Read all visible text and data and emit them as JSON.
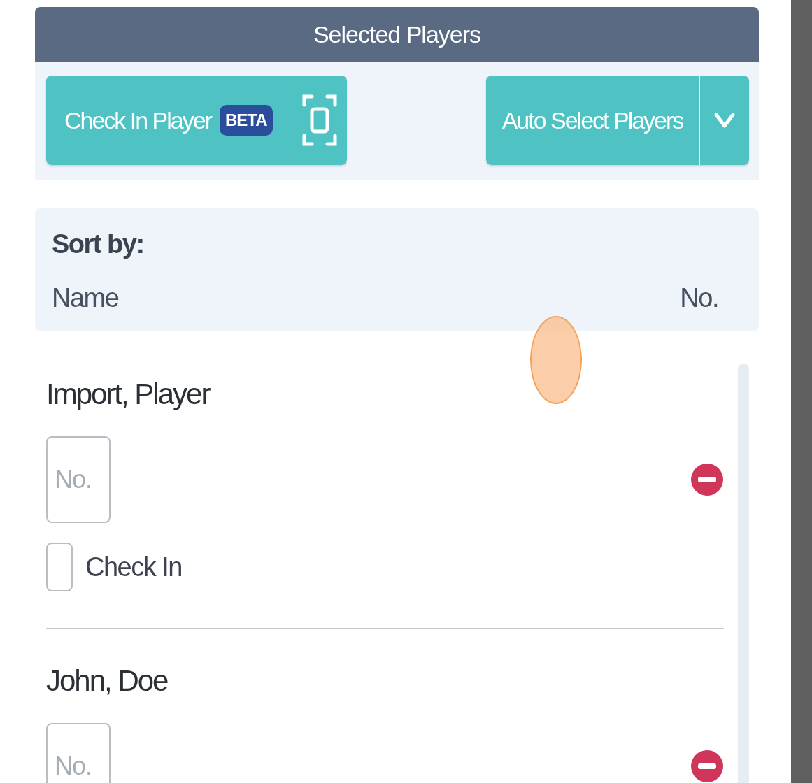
{
  "panel": {
    "title": "Selected Players"
  },
  "toolbar": {
    "check_in_button": {
      "label": "Check In Player",
      "badge": "BETA"
    },
    "auto_select_button": {
      "label": "Auto Select Players"
    }
  },
  "sort": {
    "title": "Sort by:",
    "options": [
      {
        "label": "Name"
      },
      {
        "label": "No."
      }
    ]
  },
  "players": [
    {
      "name": "Import, Player",
      "number_placeholder": "No.",
      "check_in": {
        "label": "Check In",
        "checked": false
      }
    },
    {
      "name": "John, Doe",
      "number_placeholder": "No."
    }
  ]
}
